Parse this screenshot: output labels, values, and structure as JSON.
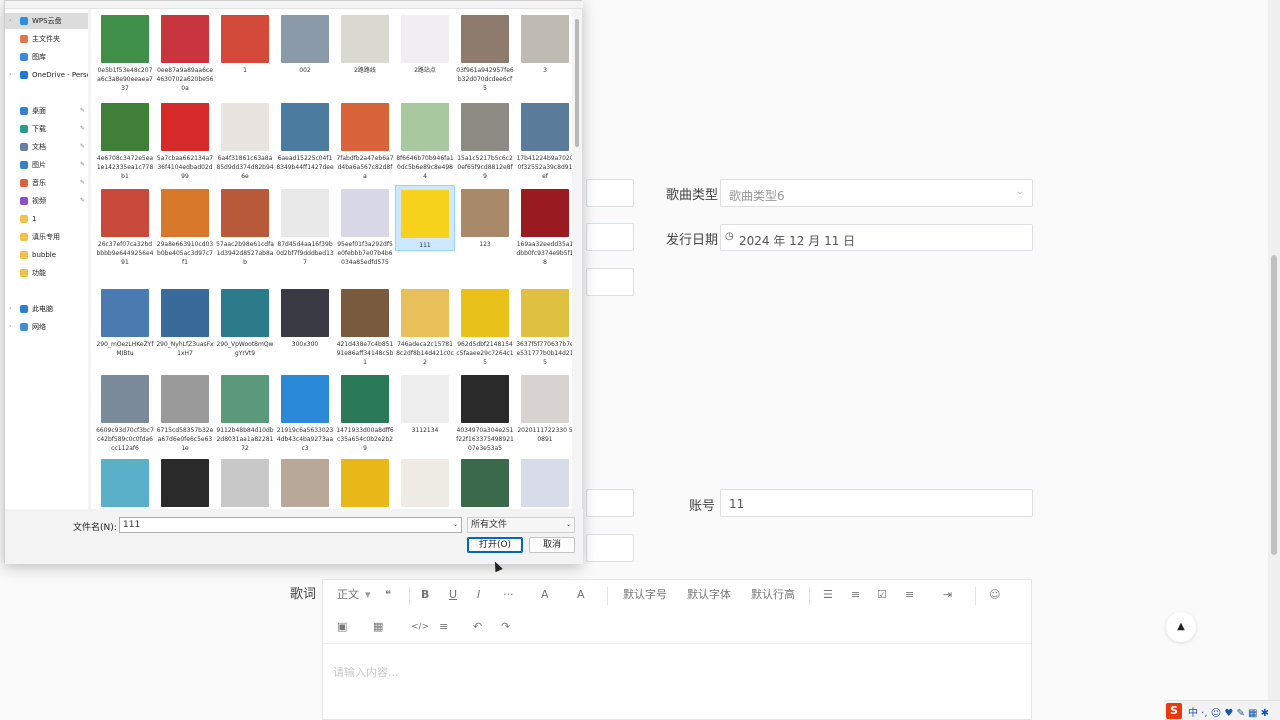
{
  "form": {
    "song_type": {
      "label": "歌曲类型",
      "value": "歌曲类型6"
    },
    "release_date": {
      "label": "发行日期",
      "value": "2024 年 12 月 11 日"
    },
    "account": {
      "label": "账号",
      "value": "11"
    },
    "lyrics": {
      "label": "歌词",
      "placeholder": "请输入内容..."
    }
  },
  "editor_toolbar": {
    "row1": [
      "正文",
      "B",
      "U",
      "I",
      "···",
      "A",
      "A",
      "默认字号",
      "默认字体",
      "默认行高",
      "☰",
      "≡",
      "☑",
      "≡",
      "⇥",
      "☺"
    ],
    "row2": [
      "▣",
      "▦",
      "</>",
      "≡",
      "↶",
      "↷"
    ]
  },
  "dialog": {
    "nav": [
      {
        "label": "WPS云盘",
        "chevron": true,
        "color": "#2f8de4",
        "selected": true
      },
      {
        "label": "主文件夹",
        "color": "#e5734a"
      },
      {
        "label": "图库",
        "color": "#3c8ad8"
      },
      {
        "label": "OneDrive - Perso",
        "chevron": true,
        "color": "#1e78d4"
      },
      {
        "label": "桌面",
        "color": "#2d83d6",
        "pin": true
      },
      {
        "label": "下载",
        "color": "#2a9d8f",
        "pin": true
      },
      {
        "label": "文档",
        "color": "#6b7fa6",
        "pin": true
      },
      {
        "label": "图片",
        "color": "#3b82c4",
        "pin": true
      },
      {
        "label": "音乐",
        "color": "#e0603a",
        "pin": true
      },
      {
        "label": "视频",
        "color": "#8a4fc9",
        "pin": true
      },
      {
        "label": "1",
        "color": "#f1c24a"
      },
      {
        "label": "滇乐专用",
        "color": "#f1c24a"
      },
      {
        "label": "bubble",
        "color": "#f1c24a"
      },
      {
        "label": "功能",
        "color": "#f1c24a"
      },
      {
        "label": "此电脑",
        "chevron": true,
        "color": "#2f7ed0"
      },
      {
        "label": "网络",
        "chevron": true,
        "color": "#3f8fd8"
      }
    ],
    "files": [
      {
        "name": "0e5b1f53e48c207a6c3a8e90eeaea737",
        "color": "#3f8f4a"
      },
      {
        "name": "0ee87a9a89aa6ce4630702a620be560a",
        "color": "#c8353f"
      },
      {
        "name": "1",
        "color": "#d44a3a"
      },
      {
        "name": "002",
        "color": "#8a9aa8"
      },
      {
        "name": "2路路线",
        "color": "#d9d9cf"
      },
      {
        "name": "2路站点",
        "color": "#f0eef0"
      },
      {
        "name": "03f961a942957fe6b32d070dcdee6cf5",
        "color": "#8f7b6e"
      },
      {
        "name": "3",
        "color": "#bfbab2"
      },
      {
        "name": "4e6708c3472e5ea1e142335ea1c778b1",
        "color": "#3f7f3a"
      },
      {
        "name": "5a7cbaa662134a736f4104edbad02d99",
        "color": "#d42a2a"
      },
      {
        "name": "6a4f31861c63a8a85d9dd374d82b946e",
        "color": "#e9e4df"
      },
      {
        "name": "6aead15225c04f18349b44ff1427dee",
        "color": "#4c7ba0"
      },
      {
        "name": "7fabdfb2a47eb6a7d4ba6a567c82d8fa",
        "color": "#d8643a"
      },
      {
        "name": "8f6646b70b946fa10dc5b6e89c8e4984",
        "color": "#a8c9a0"
      },
      {
        "name": "15a1c5217b5c6c20ef65f9cd8812e8f9",
        "color": "#8e8b84"
      },
      {
        "name": "17b41224b9a70200f32552a39c8d91ef",
        "color": "#5a7c9a"
      },
      {
        "name": "26c37ef07ca32bdbbbb9e6449256e491",
        "color": "#c74a3a"
      },
      {
        "name": "29a8e663910cd03b0be405ac3d97c7f1",
        "color": "#d8782a"
      },
      {
        "name": "57aac2b98e61cdfa1d3942d8527ab8ab",
        "color": "#b85a3a"
      },
      {
        "name": "87d45d4aa16f39b0d2bf7f9dddbed137",
        "color": "#e8e8e8"
      },
      {
        "name": "95eef01f3a292df5e0febbb7e07b4b6034a85edfd575",
        "color": "#d8d8e6"
      },
      {
        "name": "111",
        "color": "#f6d21c",
        "selected": true
      },
      {
        "name": "123",
        "color": "#a88a6a"
      },
      {
        "name": "169aa32eedd35a1dbb0fc9374e9b5f18",
        "color": "#9a1a22"
      },
      {
        "name": "290_mOezLHKeZYfMIBtu",
        "color": "#4a7ab0"
      },
      {
        "name": "290_NyhLfZ3uasFx1xH7",
        "color": "#3a6a9a"
      },
      {
        "name": "290_VpWoot8mQwgYrVt9",
        "color": "#2a7a8a"
      },
      {
        "name": "300x300",
        "color": "#3a3a44"
      },
      {
        "name": "421d438e7c4b85191e86aff34148c5b1",
        "color": "#7a5a3e"
      },
      {
        "name": "746adeca2c157818c2df8b14d421c0c2",
        "color": "#e8c05a"
      },
      {
        "name": "962d5dbf2148154c5faaee29c7264c15",
        "color": "#e8c21a"
      },
      {
        "name": "3637f5f770637b7ee531777b0b14d215",
        "color": "#e0c040"
      },
      {
        "name": "6609c93d70cf3bc7c42bf589c0c0fda6cc112af6",
        "color": "#7a8a9a"
      },
      {
        "name": "6715cd58357b32ea67d6e0fe6c5e631e",
        "color": "#9a9a9a"
      },
      {
        "name": "9112b48b84d10db2d8031aa1a8228172",
        "color": "#5a9a7a"
      },
      {
        "name": "21919c6a56330234db43c4ba9273aac3",
        "color": "#2a8ad8"
      },
      {
        "name": "1471933d00a8dff6c35a654c0b2e2b29",
        "color": "#2a7a5a"
      },
      {
        "name": "3112134",
        "color": "#eeeeee"
      },
      {
        "name": "4034970a304e251f22f16337549892107e3e53a5",
        "color": "#2a2a2a"
      },
      {
        "name": "2020111722330 50891",
        "color": "#d8d2d0"
      },
      {
        "name": "",
        "color": "#5ab0c8"
      },
      {
        "name": "",
        "color": "#2a2a2a"
      },
      {
        "name": "",
        "color": "#c8c8c8"
      },
      {
        "name": "",
        "color": "#b8a898"
      },
      {
        "name": "",
        "color": "#e8b818"
      },
      {
        "name": "",
        "color": "#efece6"
      },
      {
        "name": "",
        "color": "#3a6a4a"
      },
      {
        "name": "",
        "color": "#d8dce8"
      }
    ],
    "filename_label": "文件名(N):",
    "filename_value": "111",
    "filetype_value": "所有文件",
    "open_button": "打开(O)",
    "cancel_button": "取消"
  },
  "tray": {
    "ime": "S",
    "glyphs": "中 ·, ☺ ♥ ✎ ▦ ✱"
  },
  "back_to_top": "▲"
}
